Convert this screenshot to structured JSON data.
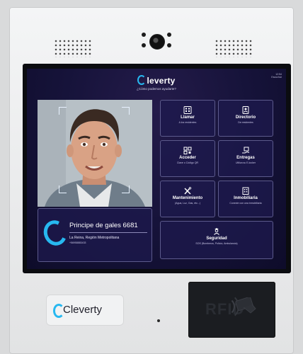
{
  "device": {
    "brand": "Cleverty"
  },
  "screen": {
    "logo_text": "leverty",
    "subtitle": "¿Cómo podemos ayudarte?",
    "status_line1": "12:54",
    "status_line2": "Escuchar",
    "tiles": [
      {
        "id": "llamar",
        "title": "Llamar",
        "subtitle": "A los residentes",
        "icon": "phone-grid-icon"
      },
      {
        "id": "directorio",
        "title": "Directorio",
        "subtitle": "De residentes",
        "icon": "contacts-book-icon"
      },
      {
        "id": "acceder",
        "title": "Acceder",
        "subtitle": "Clave o Código QR",
        "icon": "qr-key-icon"
      },
      {
        "id": "entregas",
        "title": "Entregas",
        "subtitle": "Utiliza su E-locker",
        "icon": "package-hand-icon"
      },
      {
        "id": "mantenimiento",
        "title": "Mantenimiento",
        "subtitle": "(Agua, Luz, Gas, etc...)",
        "icon": "tools-icon"
      },
      {
        "id": "inmobiliaria",
        "title": "Inmobiliaria",
        "subtitle": "Conecte con una inmobiliaria",
        "icon": "building-icon"
      }
    ],
    "security_tile": {
      "title": "Seguridad",
      "subtitle": "SOS (Bomberos, Policía, Ambulancia)",
      "icon": "security-guard-icon"
    },
    "address": {
      "name": "Principe de gales 6681",
      "region": "La Reina, Región Metropolitana",
      "phone": "+56958883433"
    }
  },
  "rfid": {
    "label": "RFID"
  },
  "colors": {
    "accent": "#27b8f0",
    "screen_bg": "#16133a",
    "tile_border": "#5c5a8c"
  }
}
